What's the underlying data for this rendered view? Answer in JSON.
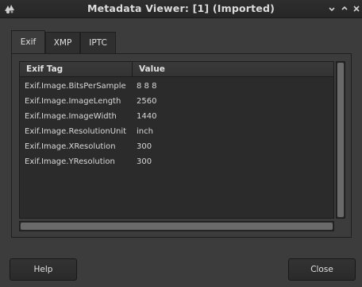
{
  "window": {
    "title": "Metadata Viewer: [1] (Imported)",
    "icons": {
      "app": "gimp-wilber-icon",
      "minimize": "minimize-icon",
      "maximize": "maximize-icon",
      "close": "close-icon"
    }
  },
  "tabs": [
    {
      "label": "Exif",
      "active": true
    },
    {
      "label": "XMP",
      "active": false
    },
    {
      "label": "IPTC",
      "active": false
    }
  ],
  "table": {
    "columns": [
      "Exif Tag",
      "Value"
    ],
    "rows": [
      {
        "tag": "Exif.Image.BitsPerSample",
        "value": "8 8 8"
      },
      {
        "tag": "Exif.Image.ImageLength",
        "value": "2560"
      },
      {
        "tag": "Exif.Image.ImageWidth",
        "value": "1440"
      },
      {
        "tag": "Exif.Image.ResolutionUnit",
        "value": "inch"
      },
      {
        "tag": "Exif.Image.XResolution",
        "value": "300"
      },
      {
        "tag": "Exif.Image.YResolution",
        "value": "300"
      }
    ]
  },
  "buttons": {
    "help": "Help",
    "close": "Close"
  },
  "colors": {
    "background": "#3c3c3c",
    "tree_background": "#2b2b2b",
    "text": "#e0e0e0"
  }
}
